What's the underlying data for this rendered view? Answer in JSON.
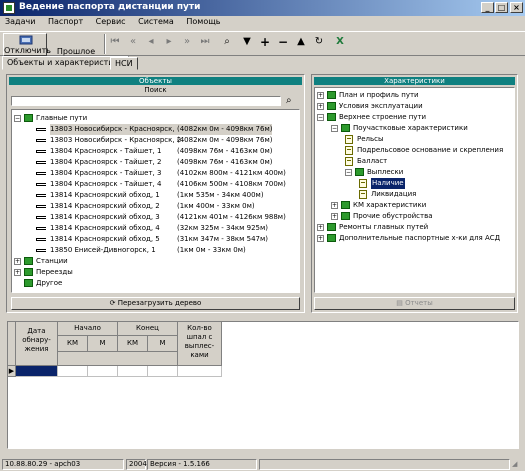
{
  "window": {
    "title": "Ведение паспорта дистанции пути"
  },
  "menu": [
    "Задачи",
    "Паспорт",
    "Сервис",
    "Система",
    "Помощь"
  ],
  "toolbar": {
    "disconnect_label": "Отключить",
    "past_label": "Прошлое"
  },
  "tabs": [
    "Объекты и характеристики",
    "НСИ"
  ],
  "left_panel": {
    "header": "Объекты",
    "search_label": "Поиск",
    "search_value": "",
    "reload_label": "Перезагрузить дерево",
    "root": "Главные пути",
    "tracks": [
      {
        "name": "13803 Новосибирск - Красноярск, 1",
        "range": "(4082км 0м - 4098км 76м)",
        "selected": true
      },
      {
        "name": "13803 Новосибирск - Красноярск, 2",
        "range": "(4082км 0м - 4098км 76м)"
      },
      {
        "name": "13804 Красноярск - Тайшет, 1",
        "range": "(4098км 76м - 4163км 0м)"
      },
      {
        "name": "13804 Красноярск - Тайшет, 2",
        "range": "(4098км 76м - 4163км 0м)"
      },
      {
        "name": "13804 Красноярск - Тайшет, 3",
        "range": "(4102км 800м - 4121км 400м)"
      },
      {
        "name": "13804 Красноярск - Тайшет, 4",
        "range": "(4106км 500м - 4108км 700м)"
      },
      {
        "name": "13814 Красноярский обход, 1",
        "range": "(1км 535м - 34км 400м)"
      },
      {
        "name": "13814 Красноярский обход, 2",
        "range": "(1км 400м - 33км 0м)"
      },
      {
        "name": "13814 Красноярский обход, 3",
        "range": "(4121км 401м - 4126км 988м)"
      },
      {
        "name": "13814 Красноярский обход, 4",
        "range": "(32км 325м - 34км 925м)"
      },
      {
        "name": "13814 Красноярский обход, 5",
        "range": "(31км 347м - 38км 547м)"
      },
      {
        "name": "13850 Енисей-Дивногорск, 1",
        "range": "(1км 0м - 33км 0м)"
      }
    ],
    "others": [
      "Станции",
      "Переезды",
      "Другое"
    ]
  },
  "right_panel": {
    "header": "Характеристики",
    "items": [
      "План и профиль пути",
      "Условия эксплуатации",
      "Верхнее строение пути",
      "Поучастковые характеристики",
      "Рельсы",
      "Подрельсовое основание и скрепления",
      "Балласт",
      "Выплески",
      "Наличие",
      "Ликвидация",
      "КМ характеристики",
      "Прочие обустройства",
      "Ремонты главных путей",
      "Дополнительные паспортные х-ки для АСД"
    ],
    "reports_label": "Отчеты"
  },
  "grid": {
    "headers": {
      "date": "Дата обнару-жения",
      "start": "Начало",
      "end": "Конец",
      "km": "КМ",
      "m": "М",
      "count": "Кол-во шпал с выплес-ками"
    }
  },
  "status": {
    "server": "10.88.80.29 - apch03",
    "year": "2004",
    "version": "Версия - 1.5.166"
  }
}
